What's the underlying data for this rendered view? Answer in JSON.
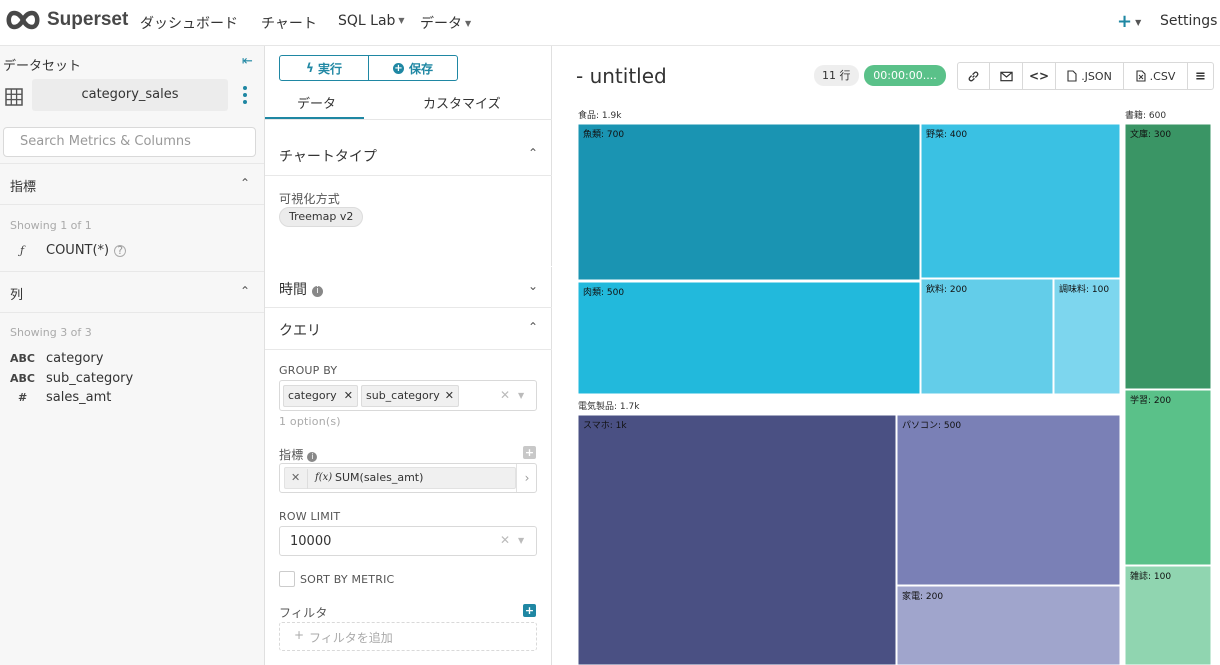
{
  "nav": {
    "brand": "Superset",
    "dashboards": "ダッシュボード",
    "charts": "チャート",
    "sql_lab": "SQL Lab",
    "data": "データ",
    "settings": "Settings"
  },
  "dataset_panel": {
    "title": "データセット",
    "dataset_name": "category_sales",
    "search_placeholder": "Search Metrics & Columns",
    "metrics_section": "指標",
    "metrics_showing": "Showing 1 of 1",
    "metrics": [
      {
        "type_icon": "ƒ",
        "name": "COUNT(*)"
      }
    ],
    "columns_section": "列",
    "columns_showing": "Showing 3 of 3",
    "columns": [
      {
        "type": "ABC",
        "name": "category"
      },
      {
        "type": "ABC",
        "name": "sub_category"
      },
      {
        "type": "#",
        "name": "sales_amt"
      }
    ]
  },
  "control_panel": {
    "run_label": "実行",
    "save_label": "保存",
    "tab_data": "データ",
    "tab_customize": "カスタマイズ",
    "chart_type_section": "チャートタイプ",
    "viz_label": "可視化方式",
    "viz_value": "Treemap v2",
    "time_section": "時間",
    "query_section": "クエリ",
    "group_by_label": "GROUP BY",
    "group_by_tags": [
      "category",
      "sub_category"
    ],
    "group_by_hint": "1 option(s)",
    "metrics_label": "指標",
    "metric_value": "SUM(sales_amt)",
    "metric_prefix": "f(x)",
    "row_limit_label": "ROW LIMIT",
    "row_limit_value": "10000",
    "sort_by_metric_label": "SORT BY METRIC",
    "filters_label": "フィルタ",
    "add_filter_placeholder": "フィルタを追加"
  },
  "chart_header": {
    "title": "- untitled",
    "row_count": "11 行",
    "timer": "00:00:00....",
    "json_label": ".JSON",
    "csv_label": ".CSV"
  },
  "colors": {
    "accent": "#1f87a3",
    "success": "#5ac189"
  },
  "chart_data": {
    "type": "treemap",
    "groups": [
      {
        "name": "食品",
        "label": "食品: 1.9k",
        "children": [
          {
            "name": "魚類",
            "label": "魚類: 700",
            "value": 700,
            "color": "#1a94b2"
          },
          {
            "name": "肉類",
            "label": "肉類: 500",
            "value": 500,
            "color": "#22b9dc"
          },
          {
            "name": "野菜",
            "label": "野菜: 400",
            "value": 400,
            "color": "#3ac1e3"
          },
          {
            "name": "飲料",
            "label": "飲料: 200",
            "value": 200,
            "color": "#63cde9"
          },
          {
            "name": "調味料",
            "label": "調味料: 100",
            "value": 100,
            "color": "#7dd6ee"
          }
        ]
      },
      {
        "name": "電気製品",
        "label": "電気製品: 1.7k",
        "children": [
          {
            "name": "スマホ",
            "label": "スマホ: 1k",
            "value": 1000,
            "color": "#4a5083"
          },
          {
            "name": "パソコン",
            "label": "パソコン: 500",
            "value": 500,
            "color": "#7a80b6"
          },
          {
            "name": "家電",
            "label": "家電: 200",
            "value": 200,
            "color": "#a0a5cc"
          }
        ]
      },
      {
        "name": "書籍",
        "label": "書籍: 600",
        "children": [
          {
            "name": "文庫",
            "label": "文庫: 300",
            "value": 300,
            "color": "#3a9565"
          },
          {
            "name": "学習",
            "label": "学習: 200",
            "value": 200,
            "color": "#5ac189"
          },
          {
            "name": "雑誌",
            "label": "雑誌: 100",
            "value": 100,
            "color": "#90d5b0"
          }
        ]
      }
    ]
  }
}
